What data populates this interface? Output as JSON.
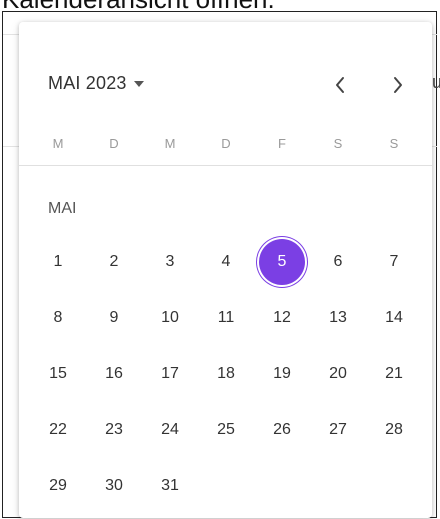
{
  "caption": "Kalenderansicht öffnen.",
  "background": {
    "edge_text": "u"
  },
  "calendar": {
    "month_label": "MAI 2023",
    "section_label": "MAI",
    "weekdays": [
      "M",
      "D",
      "M",
      "D",
      "F",
      "S",
      "S"
    ],
    "first_weekday_index": 0,
    "days": [
      "1",
      "2",
      "3",
      "4",
      "5",
      "6",
      "7",
      "8",
      "9",
      "10",
      "11",
      "12",
      "13",
      "14",
      "15",
      "16",
      "17",
      "18",
      "19",
      "20",
      "21",
      "22",
      "23",
      "24",
      "25",
      "26",
      "27",
      "28",
      "29",
      "30",
      "31"
    ],
    "selected_day": "5"
  },
  "colors": {
    "accent": "#7b3fe4",
    "text": "#333333",
    "weekday_text": "#9a9a9a",
    "divider": "#e0e0e0"
  },
  "icons": {
    "month_dropdown": "caret-down-icon",
    "prev": "chevron-left-icon",
    "next": "chevron-right-icon"
  }
}
